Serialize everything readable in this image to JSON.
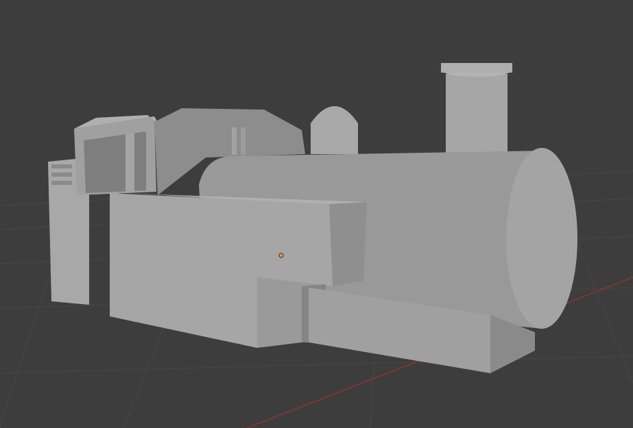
{
  "viewport": {
    "background": "#3d3d3d",
    "grid_color": "#4a4a4a",
    "x_axis_color": "#9a3a3a",
    "origin_color": "#ff9a1f"
  },
  "model": {
    "base_color": "#9e9e9e",
    "light_color": "#b4b4b4",
    "dark_color": "#7c7c7c",
    "edge_color": "#8a8a8a"
  },
  "icons": {
    "origin": "origin-dot-icon"
  }
}
